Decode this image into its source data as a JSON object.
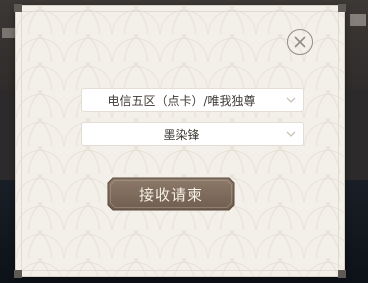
{
  "dialog": {
    "server_select": {
      "value": "电信五区（点卡）/唯我独尊"
    },
    "character_select": {
      "value": "墨染锋"
    },
    "submit_label": "接收请柬"
  },
  "icons": {
    "close": "close-circle-icon",
    "chevron": "chevron-down-icon"
  },
  "colors": {
    "dialog_bg": "#f3efe9",
    "button_bg": "#7e6b5c",
    "text": "#3f3a36"
  }
}
